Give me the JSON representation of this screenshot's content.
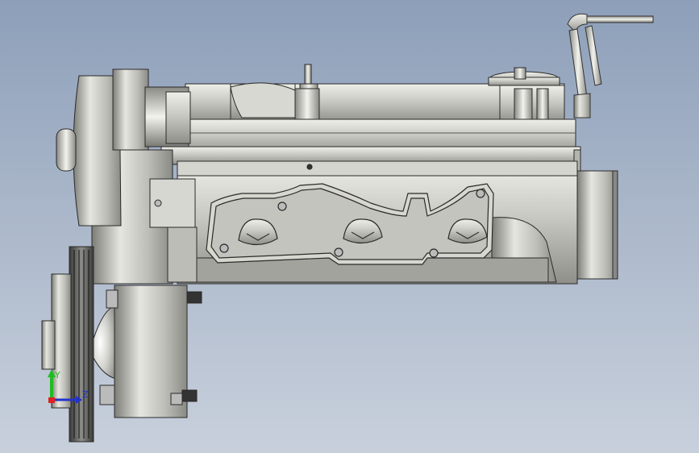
{
  "viewport": {
    "background_top": "#8d9fb9",
    "background_bottom": "#c8d0dc"
  },
  "model": {
    "render_style": "shaded-with-edges",
    "metal_color": "#c8c8c2",
    "edge_color": "#2a2a2a"
  },
  "triad": {
    "y_axis_color": "#22bb22",
    "z_axis_color": "#2233cc",
    "y_label": "Y",
    "z_label": "Z"
  }
}
